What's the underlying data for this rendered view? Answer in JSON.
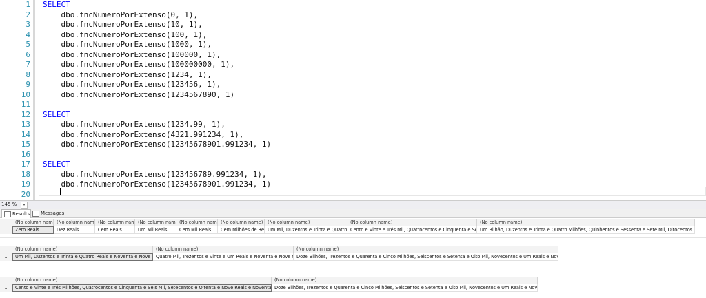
{
  "editor": {
    "lines": [
      {
        "n": "1",
        "kw": "SELECT",
        "text": "",
        "indent": ""
      },
      {
        "n": "2",
        "kw": "",
        "text": "dbo.fncNumeroPorExtenso(0, 1),",
        "indent": "    "
      },
      {
        "n": "3",
        "kw": "",
        "text": "dbo.fncNumeroPorExtenso(10, 1),",
        "indent": "    "
      },
      {
        "n": "4",
        "kw": "",
        "text": "dbo.fncNumeroPorExtenso(100, 1),",
        "indent": "    "
      },
      {
        "n": "5",
        "kw": "",
        "text": "dbo.fncNumeroPorExtenso(1000, 1),",
        "indent": "    "
      },
      {
        "n": "6",
        "kw": "",
        "text": "dbo.fncNumeroPorExtenso(100000, 1),",
        "indent": "    "
      },
      {
        "n": "7",
        "kw": "",
        "text": "dbo.fncNumeroPorExtenso(100000000, 1),",
        "indent": "    "
      },
      {
        "n": "8",
        "kw": "",
        "text": "dbo.fncNumeroPorExtenso(1234, 1),",
        "indent": "    "
      },
      {
        "n": "9",
        "kw": "",
        "text": "dbo.fncNumeroPorExtenso(123456, 1),",
        "indent": "    "
      },
      {
        "n": "10",
        "kw": "",
        "text": "dbo.fncNumeroPorExtenso(1234567890, 1)",
        "indent": "    "
      },
      {
        "n": "11",
        "kw": "",
        "text": "",
        "indent": ""
      },
      {
        "n": "12",
        "kw": "SELECT",
        "text": "",
        "indent": ""
      },
      {
        "n": "13",
        "kw": "",
        "text": "dbo.fncNumeroPorExtenso(1234.99, 1),",
        "indent": "    "
      },
      {
        "n": "14",
        "kw": "",
        "text": "dbo.fncNumeroPorExtenso(4321.991234, 1),",
        "indent": "    "
      },
      {
        "n": "15",
        "kw": "",
        "text": "dbo.fncNumeroPorExtenso(12345678901.991234, 1)",
        "indent": "    "
      },
      {
        "n": "16",
        "kw": "",
        "text": "",
        "indent": ""
      },
      {
        "n": "17",
        "kw": "SELECT",
        "text": "",
        "indent": ""
      },
      {
        "n": "18",
        "kw": "",
        "text": "dbo.fncNumeroPorExtenso(123456789.991234, 1),",
        "indent": "    "
      },
      {
        "n": "19",
        "kw": "",
        "text": "dbo.fncNumeroPorExtenso(12345678901.991234, 1)",
        "indent": "    "
      },
      {
        "n": "20",
        "kw": "",
        "text": "",
        "indent": ""
      }
    ]
  },
  "zoom": {
    "level": "145 %"
  },
  "tabs": {
    "results": "Results",
    "messages": "Messages"
  },
  "grids": [
    {
      "headers": [
        "(No column name)",
        "(No column name)",
        "(No column name)",
        "(No column name)",
        "(No column name)",
        "(No column name)",
        "(No column name)",
        "(No column name)",
        "(No column name)"
      ],
      "rows": [
        [
          "1",
          "Zero Reais",
          "Dez Reais",
          "Cem Reais",
          "Um Mil Reais",
          "Cem Mil Reais",
          "Cem Milhões de Reais",
          "Um Mil, Duzentos e Trinta e Quatro Reais",
          "Cento e Vinte e Três Mil, Quatrocentos e Cinquenta e Seis Reais",
          "Um Bilhão, Duzentos e Trinta e Quatro Milhões, Quinhentos e Sessenta e Sete Mil, Oitocentos e Noventa Reais"
        ]
      ]
    },
    {
      "headers": [
        "(No column name)",
        "(No column name)",
        "(No column name)"
      ],
      "rows": [
        [
          "1",
          "Um Mil, Duzentos e Trinta e Quatro Reais e Noventa e Nove Centavos",
          "Quatro Mil, Trezentos e Vinte e Um Reais e Noventa e Nove Centavos",
          "Doze Bilhões, Trezentos e Quarenta e Cinco Milhões, Seiscentos e Setenta e Oito Mil, Novecentos e Um Reais e Noventa e Nove Centavos"
        ]
      ]
    },
    {
      "headers": [
        "(No column name)",
        "(No column name)"
      ],
      "rows": [
        [
          "1",
          "Cento e Vinte e Três Milhões, Quatrocentos e Cinquenta e Seis Mil, Setecentos e Oitenta e Nove Reais e Noventa e Nove Centavos",
          "Doze Bilhões, Trezentos e Quarenta e Cinco Milhões, Seiscentos e Setenta e Oito Mil, Novecentos e Um Reais e Noventa e Nove Centavos"
        ]
      ]
    }
  ]
}
